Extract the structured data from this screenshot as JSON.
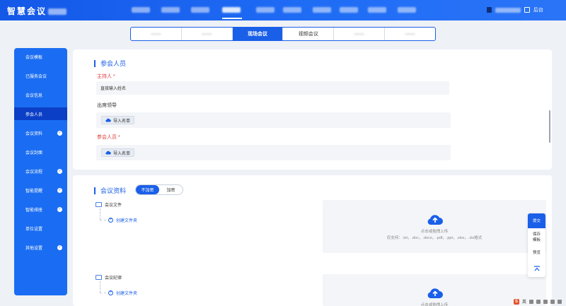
{
  "header": {
    "brand": "智慧会议",
    "right_label": "后台"
  },
  "tabs": [
    {
      "label": "",
      "active": false,
      "blurred": true
    },
    {
      "label": "",
      "active": false,
      "blurred": true
    },
    {
      "label": "现场会议",
      "active": true,
      "blurred": false
    },
    {
      "label": "视频会议",
      "active": false,
      "blurred": false
    },
    {
      "label": "",
      "active": false,
      "blurred": true
    },
    {
      "label": "",
      "active": false,
      "blurred": true
    }
  ],
  "sidebar": {
    "items": [
      {
        "label": "会议模板",
        "checked": false,
        "active": false
      },
      {
        "label": "已服务会议",
        "checked": false,
        "active": false
      },
      {
        "label": "会议信息",
        "checked": false,
        "active": false
      },
      {
        "label": "参会人员",
        "checked": false,
        "active": true
      },
      {
        "label": "会议资料",
        "checked": true,
        "active": false
      },
      {
        "label": "会议封面",
        "checked": false,
        "active": false
      },
      {
        "label": "会议流程",
        "checked": true,
        "active": false
      },
      {
        "label": "智能提醒",
        "checked": true,
        "active": false
      },
      {
        "label": "智能排座",
        "checked": true,
        "active": false
      },
      {
        "label": "单位设置",
        "checked": false,
        "active": false
      },
      {
        "label": "其他设置",
        "checked": true,
        "active": false
      }
    ]
  },
  "attendees": {
    "title": "参会人员",
    "host_label": "主持人",
    "host_placeholder": "直接输入姓名",
    "leaders_label": "出席领导",
    "import_label": "导入名单",
    "participants_label": "参会人员",
    "required_mark": "*"
  },
  "materials": {
    "title": "会议资料",
    "toggle_off": "不加密",
    "toggle_on": "加密",
    "folders": [
      {
        "name": "会议文件",
        "create_label": "创建文件夹"
      },
      {
        "name": "会议纪律",
        "create_label": "创建文件夹"
      }
    ],
    "upload_hint": "点击或拖拽上传",
    "upload_formats": "仅支持：.txt，.doc，.docx，.pdf，.ppt，.xlsx，.xls格式"
  },
  "float_panel": {
    "submit": "提交",
    "save_template": "保存模板",
    "preview": "预览"
  },
  "tray": {
    "lang": "英"
  }
}
